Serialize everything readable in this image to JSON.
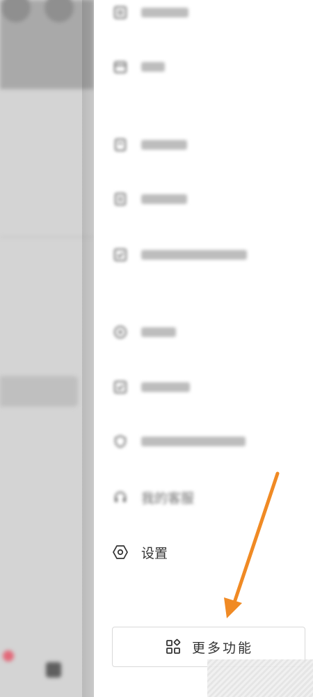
{
  "drawer": {
    "items": [
      {
        "key": "item-1",
        "icon": "list-icon",
        "label": ""
      },
      {
        "key": "item-2",
        "icon": "calendar-icon",
        "label": ""
      },
      {
        "key": "item-3",
        "icon": "document-icon",
        "label": ""
      },
      {
        "key": "item-4",
        "icon": "document-icon",
        "label": ""
      },
      {
        "key": "item-5",
        "icon": "checkbox-icon",
        "label": ""
      },
      {
        "key": "item-6",
        "icon": "mini-program-icon",
        "label": ""
      },
      {
        "key": "item-7",
        "icon": "check-square-icon",
        "label": ""
      },
      {
        "key": "item-8",
        "icon": "shield-icon",
        "label": ""
      },
      {
        "key": "customer-service",
        "icon": "headset-icon",
        "label": "我的客服"
      },
      {
        "key": "settings",
        "icon": "hexagon-settings-icon",
        "label": "设置"
      }
    ],
    "more_button": {
      "label": "更多功能",
      "icon": "grid-icon"
    }
  },
  "colors": {
    "annotation_arrow": "#f08a24",
    "drawer_background": "#ffffff",
    "text_primary": "#333333"
  }
}
